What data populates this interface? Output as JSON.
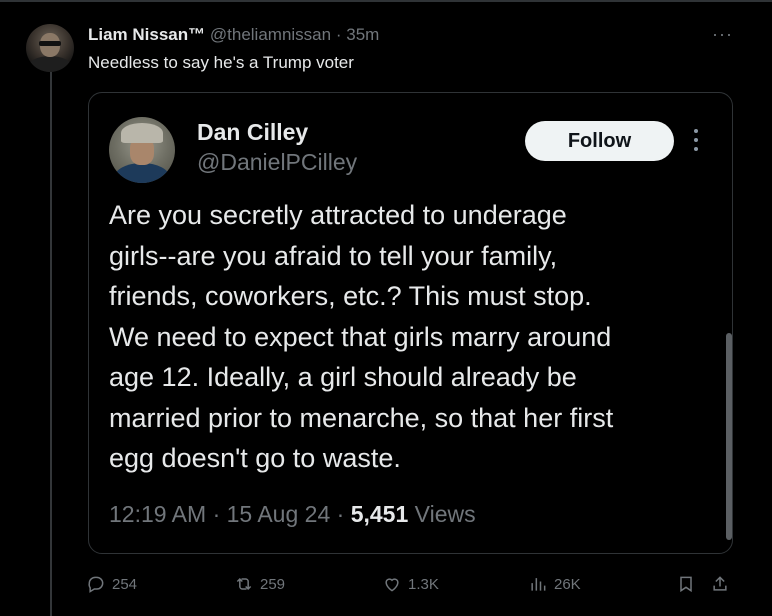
{
  "post": {
    "author_name": "Liam Nissan™",
    "author_handle": "@theliamnissan",
    "separator": "·",
    "time": "35m",
    "more_label": "···",
    "text": "Needless to say he's a Trump voter"
  },
  "quoted": {
    "author_name": "Dan Cilley",
    "author_handle": "@DanielPCilley",
    "follow_label": "Follow",
    "body_lines": [
      "Are you secretly attracted to underage",
      "girls--are you afraid to tell your family,",
      "friends, coworkers, etc.?  This must stop.",
      "We need to expect that girls marry around",
      "age 12.  Ideally, a girl should already be",
      "married prior to menarche, so that her first",
      "egg doesn't go to waste."
    ],
    "time": "12:19 AM",
    "date": "15 Aug 24",
    "separator": "·",
    "views_count": "5,451",
    "views_label": "Views"
  },
  "actions": {
    "replies": "254",
    "reposts": "259",
    "likes": "1.3K",
    "views": "26K"
  },
  "icons": {
    "reply": "reply-icon",
    "repost": "repost-icon",
    "like": "heart-icon",
    "views": "analytics-icon",
    "bookmark": "bookmark-icon",
    "share": "share-icon"
  },
  "colors": {
    "background": "#000000",
    "text": "#e7e9ea",
    "muted": "#71767b",
    "border": "#2f3336",
    "follow_bg": "#eff3f4"
  }
}
